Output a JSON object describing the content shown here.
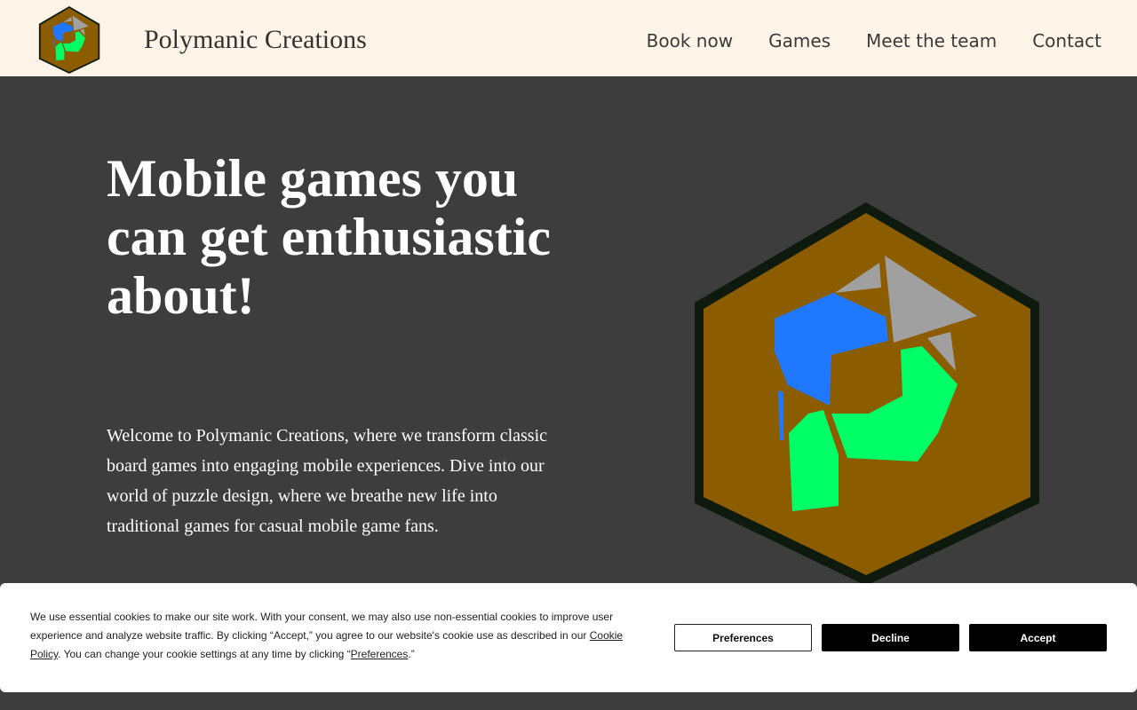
{
  "header": {
    "brand": "Polymanic Creations",
    "nav": [
      "Book now",
      "Games",
      "Meet the team",
      "Contact"
    ]
  },
  "hero": {
    "title": "Mobile games you can get enthusiastic about!",
    "description": "Welcome to Polymanic Creations, where we transform classic board games into engaging mobile experiences. Dive into our world of puzzle design, where we breathe new life into traditional games for casual mobile game fans."
  },
  "cookie_banner": {
    "text_before_link": "We use essential cookies to make our site work. With your consent, we may also use non-essential cookies to improve user experience and analyze website traffic. By clicking “Accept,” you agree to our website's cookie use as described in our ",
    "cookie_policy_link": "Cookie Policy",
    "text_middle": ". You can change your cookie settings at any time by clicking “",
    "preferences_link": "Preferences",
    "text_end": ".”",
    "buttons": {
      "preferences": "Preferences",
      "decline": "Decline",
      "accept": "Accept"
    }
  },
  "colors": {
    "header_bg": "#fff4e8",
    "page_bg": "#3d3d3d",
    "logo_hex_fill": "#8b5d00",
    "logo_hex_border": "#0f1a0f",
    "logo_blue": "#1f78ff",
    "logo_green": "#00ff66",
    "logo_gray": "#a0a0a0"
  },
  "icons": {
    "site_logo": "hexagon-puzzle-logo",
    "hero_image": "hexagon-puzzle-logo-large"
  }
}
